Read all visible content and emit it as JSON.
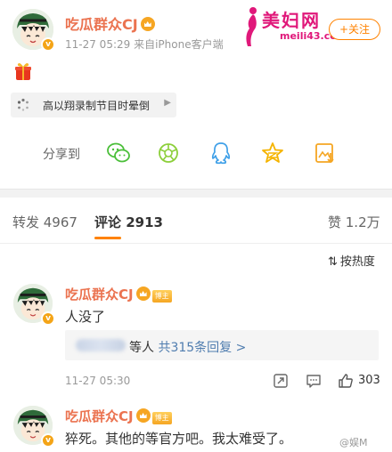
{
  "post": {
    "author": "吃瓜群众CJ",
    "meta": "11-27 05:29  来自iPhone客户端",
    "follow_label": "+关注",
    "topic": "高以翔录制节目时晕倒",
    "share_label": "分享到"
  },
  "watermark": {
    "title": "美妇网",
    "url": "meili43.com"
  },
  "tabs": [
    {
      "label": "转发 4967"
    },
    {
      "label": "评论 2913"
    },
    {
      "label": "赞 1.2万"
    }
  ],
  "sort_label": "按热度",
  "comments": [
    {
      "author": "吃瓜群众CJ",
      "badge": "博主",
      "text": "人没了",
      "reply_prefix": "等人",
      "reply_link": "共315条回复 >",
      "time": "11-27 05:30",
      "likes": "303"
    },
    {
      "author": "吃瓜群众CJ",
      "badge": "博主",
      "text": "猝死。其他的等官方吧。我太难受了。"
    }
  ],
  "footer_watermark": "@娱M",
  "colors": {
    "name": "#eb7350",
    "accent": "#ff8200",
    "link": "#507daf",
    "vip": "#f6a623"
  },
  "icons": [
    "wechat-icon",
    "moments-icon",
    "qq-icon",
    "qzone-icon",
    "save-image-icon",
    "share-icon",
    "comment-icon",
    "like-icon",
    "sort-icon"
  ]
}
